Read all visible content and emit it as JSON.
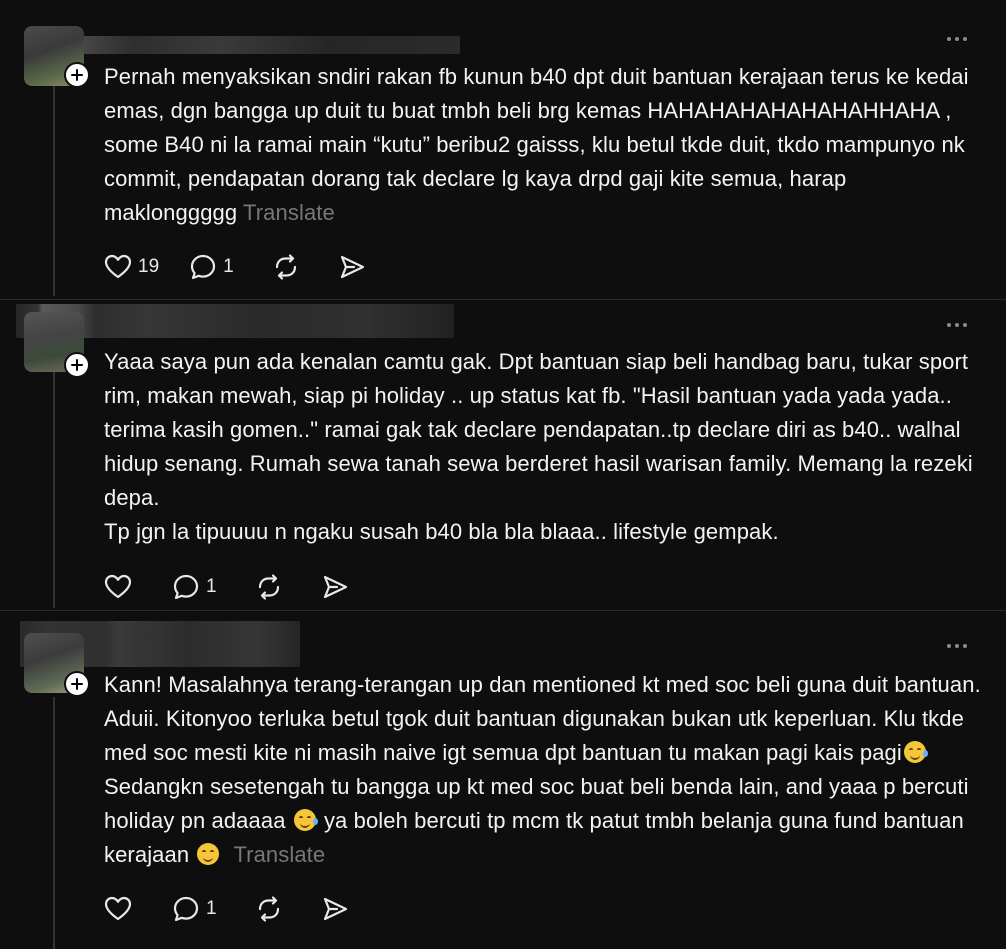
{
  "posts": [
    {
      "text": "Pernah menyaksikan sndiri rakan fb kunun b40 dpt duit bantuan kerajaan terus ke kedai emas, dgn bangga up duit tu buat tmbh beli brg kemas HAHAHAHAHAHAHAHHAHA , some B40 ni la ramai main “kutu” beribu2 gaisss, klu betul tkde duit, tkdo mampunyo nk commit, pendapatan dorang tak declare lg kaya drpd gaji kite semua, harap maklonggggg",
      "translate": "Translate",
      "likes": "19",
      "replies": "1"
    },
    {
      "text": "Yaaa saya pun ada kenalan camtu gak. Dpt bantuan siap beli handbag baru, tukar sport rim, makan mewah, siap pi holiday .. up status kat fb. \"Hasil bantuan yada yada yada.. terima kasih gomen..\" ramai gak tak declare pendapatan..tp declare diri as b40.. walhal hidup senang. Rumah sewa tanah sewa berderet hasil warisan family. Memang la rezeki depa.\nTp jgn la tipuuuu n ngaku susah b40 bla bla blaaa.. lifestyle gempak.",
      "likes": "",
      "replies": "1"
    },
    {
      "text_parts": [
        "Kann! Masalahnya terang-terangan up dan mentioned kt med soc beli guna duit bantuan. Aduii. Kitonyoo terluka betul tgok duit bantuan digunakan bukan utk keperluan. Klu tkde med soc mesti kite ni masih naive igt semua dpt bantuan tu makan pagi kais pagi",
        " Sedangkn sesetengah tu bangga up kt med soc buat beli benda lain, and yaaa p bercuti holiday pn adaaaa ",
        " ya boleh bercuti tp mcm tk patut tmbh belanja guna fund bantuan kerajaan "
      ],
      "emojis": [
        "rofl-emoji",
        "rofl-emoji",
        "relieved-emoji"
      ],
      "translate": "Translate",
      "likes": "",
      "replies": "1"
    }
  ],
  "colors": {
    "background": "#0e0e0e",
    "text": "#f3f3f3",
    "muted": "#777777",
    "divider": "#2a2a2a"
  }
}
